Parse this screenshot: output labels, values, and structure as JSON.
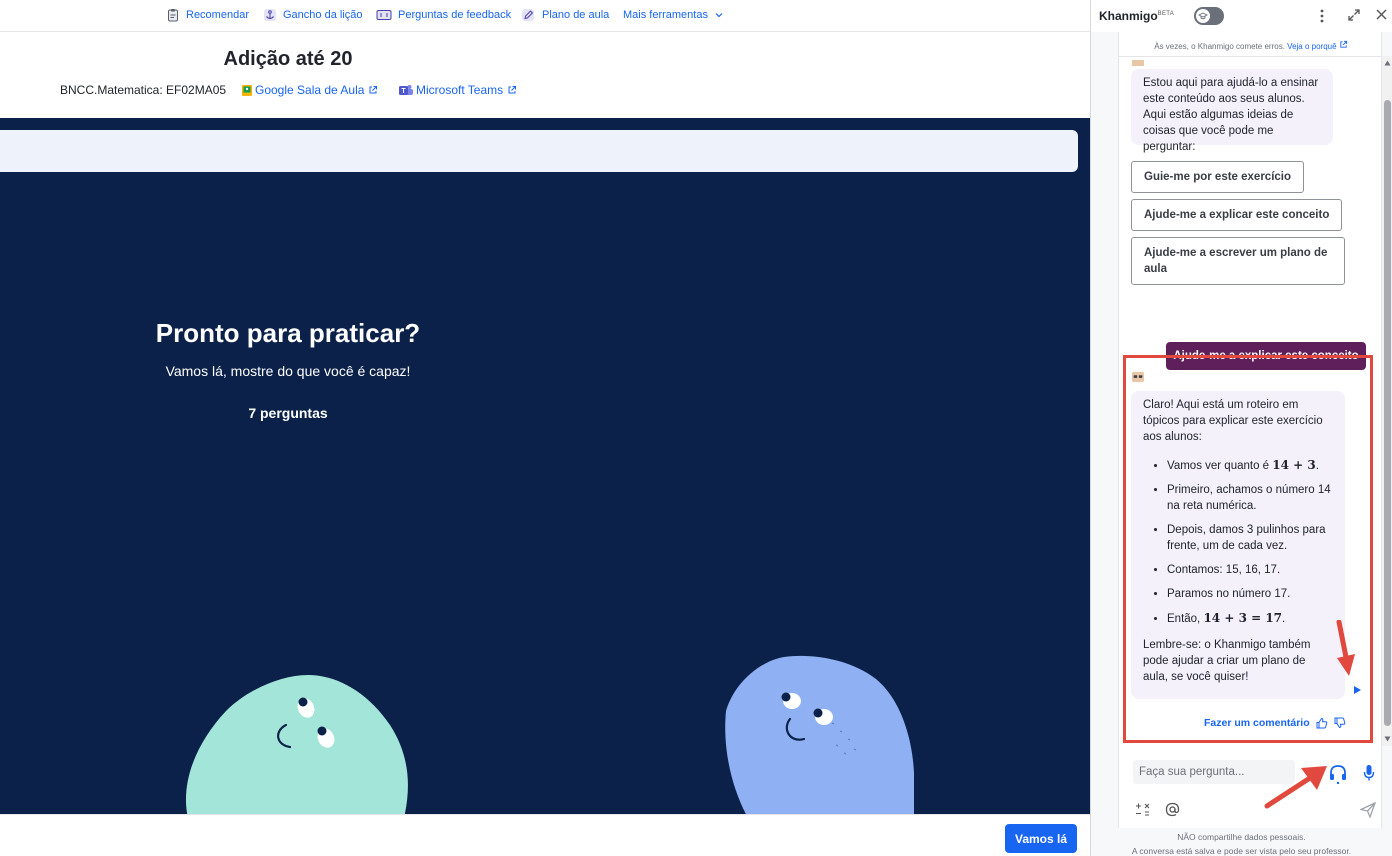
{
  "toolbar": {
    "items": [
      {
        "label": "Recomendar",
        "icon": "clipboard-icon"
      },
      {
        "label": "Gancho da lição",
        "icon": "anchor-icon"
      },
      {
        "label": "Perguntas de feedback",
        "icon": "ticket-icon"
      },
      {
        "label": "Plano de aula",
        "icon": "pencil-icon"
      },
      {
        "label": "Mais ferramentas",
        "icon": "chevron-down-icon"
      }
    ]
  },
  "lesson": {
    "title": "Adição até 20",
    "standard": "BNCC.Matematica: EF02MA05",
    "google_classroom": "Google Sala de Aula",
    "teams": "Microsoft Teams"
  },
  "practice": {
    "title": "Pronto para praticar?",
    "subtitle": "Vamos lá, mostre do que você é capaz!",
    "count": "7 perguntas"
  },
  "footer": {
    "go_label": "Vamos lá"
  },
  "khanmigo": {
    "title": "Khanmigo",
    "beta": "BETA",
    "disclaimer": "Às vezes, o Khanmigo comete erros.",
    "disclaimer_link": "Veja o porquê",
    "intro": "Estou aqui para ajudá-lo a ensinar este conteúdo aos seus alunos. Aqui estão algumas ideias de coisas que você pode me perguntar:",
    "suggestions": [
      "Guie-me por este exercício",
      "Ajude-me a explicar este conceito",
      "Ajude-me a escrever um plano de aula"
    ],
    "user_message": "Ajude-me a explicar este conceito",
    "answer": {
      "intro": "Claro! Aqui está um roteiro em tópicos para explicar este exercício aos alunos:",
      "bullet1_text": "Vamos ver quanto é",
      "bullet1_math": "14 + 3",
      "bullet2": "Primeiro, achamos o número 14 na reta numérica.",
      "bullet3": "Depois, damos 3 pulinhos para frente, um de cada vez.",
      "bullet4": "Contamos: 15, 16, 17.",
      "bullet5": "Paramos no número 17.",
      "bullet6_text": "Então,",
      "bullet6_math": "14 + 3 = 17",
      "outro": "Lembre-se: o Khanmigo também pode ajudar a criar um plano de aula, se você quiser!"
    },
    "comment_label": "Fazer um comentário",
    "input_placeholder": "Faça sua pergunta...",
    "privacy_line1": "NÃO compartilhe dados pessoais.",
    "privacy_line2": "A conversa está salva e pode ser vista pelo seu professor."
  },
  "colors": {
    "accent": "#1865f2",
    "practice_bg": "#0b2149",
    "user_bubble": "#5f1f5b",
    "highlight": "#e2493e"
  }
}
